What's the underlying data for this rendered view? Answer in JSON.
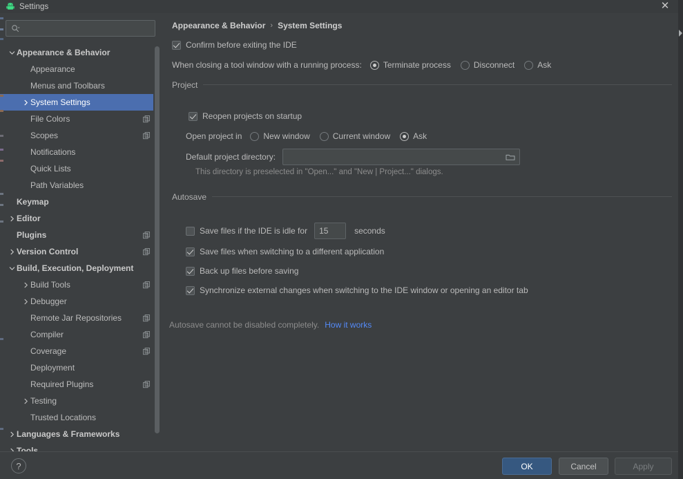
{
  "window": {
    "title": "Settings",
    "app_icon": "android-icon",
    "close_icon": "close-icon"
  },
  "sidebar": {
    "search": {
      "value": "",
      "placeholder": "",
      "icon": "search-icon"
    },
    "items": [
      {
        "label": "Appearance & Behavior",
        "indent": 0,
        "arrow": "down",
        "bold": true,
        "copy": false,
        "selected": false
      },
      {
        "label": "Appearance",
        "indent": 1,
        "arrow": "none",
        "bold": false,
        "copy": false,
        "selected": false
      },
      {
        "label": "Menus and Toolbars",
        "indent": 1,
        "arrow": "none",
        "bold": false,
        "copy": false,
        "selected": false
      },
      {
        "label": "System Settings",
        "indent": 1,
        "arrow": "right",
        "bold": false,
        "copy": false,
        "selected": true
      },
      {
        "label": "File Colors",
        "indent": 1,
        "arrow": "none",
        "bold": false,
        "copy": true,
        "selected": false
      },
      {
        "label": "Scopes",
        "indent": 1,
        "arrow": "none",
        "bold": false,
        "copy": true,
        "selected": false
      },
      {
        "label": "Notifications",
        "indent": 1,
        "arrow": "none",
        "bold": false,
        "copy": false,
        "selected": false
      },
      {
        "label": "Quick Lists",
        "indent": 1,
        "arrow": "none",
        "bold": false,
        "copy": false,
        "selected": false
      },
      {
        "label": "Path Variables",
        "indent": 1,
        "arrow": "none",
        "bold": false,
        "copy": false,
        "selected": false
      },
      {
        "label": "Keymap",
        "indent": 0,
        "arrow": "none",
        "bold": true,
        "copy": false,
        "selected": false
      },
      {
        "label": "Editor",
        "indent": 0,
        "arrow": "right",
        "bold": true,
        "copy": false,
        "selected": false
      },
      {
        "label": "Plugins",
        "indent": 0,
        "arrow": "none",
        "bold": true,
        "copy": true,
        "selected": false
      },
      {
        "label": "Version Control",
        "indent": 0,
        "arrow": "right",
        "bold": true,
        "copy": true,
        "selected": false
      },
      {
        "label": "Build, Execution, Deployment",
        "indent": 0,
        "arrow": "down",
        "bold": true,
        "copy": false,
        "selected": false
      },
      {
        "label": "Build Tools",
        "indent": 1,
        "arrow": "right",
        "bold": false,
        "copy": true,
        "selected": false
      },
      {
        "label": "Debugger",
        "indent": 1,
        "arrow": "right",
        "bold": false,
        "copy": false,
        "selected": false
      },
      {
        "label": "Remote Jar Repositories",
        "indent": 1,
        "arrow": "none",
        "bold": false,
        "copy": true,
        "selected": false
      },
      {
        "label": "Compiler",
        "indent": 1,
        "arrow": "none",
        "bold": false,
        "copy": true,
        "selected": false
      },
      {
        "label": "Coverage",
        "indent": 1,
        "arrow": "none",
        "bold": false,
        "copy": true,
        "selected": false
      },
      {
        "label": "Deployment",
        "indent": 1,
        "arrow": "none",
        "bold": false,
        "copy": false,
        "selected": false
      },
      {
        "label": "Required Plugins",
        "indent": 1,
        "arrow": "none",
        "bold": false,
        "copy": true,
        "selected": false
      },
      {
        "label": "Testing",
        "indent": 1,
        "arrow": "right",
        "bold": false,
        "copy": false,
        "selected": false
      },
      {
        "label": "Trusted Locations",
        "indent": 1,
        "arrow": "none",
        "bold": false,
        "copy": false,
        "selected": false
      },
      {
        "label": "Languages & Frameworks",
        "indent": 0,
        "arrow": "right",
        "bold": true,
        "copy": false,
        "selected": false
      },
      {
        "label": "Tools",
        "indent": 0,
        "arrow": "right",
        "bold": true,
        "copy": false,
        "selected": false
      }
    ]
  },
  "content": {
    "breadcrumb": {
      "parent": "Appearance & Behavior",
      "separator": "›",
      "current": "System Settings"
    },
    "confirm_exit": {
      "label": "Confirm before exiting the IDE",
      "checked": true
    },
    "tool_window": {
      "label": "When closing a tool window with a running process:",
      "options": [
        {
          "label": "Terminate process",
          "selected": true
        },
        {
          "label": "Disconnect",
          "selected": false
        },
        {
          "label": "Ask",
          "selected": false
        }
      ]
    },
    "project": {
      "group_label": "Project",
      "reopen": {
        "label": "Reopen projects on startup",
        "checked": true
      },
      "open_in": {
        "label": "Open project in",
        "options": [
          {
            "label": "New window",
            "selected": false
          },
          {
            "label": "Current window",
            "selected": false
          },
          {
            "label": "Ask",
            "selected": true
          }
        ]
      },
      "default_dir": {
        "label": "Default project directory:",
        "value": "",
        "placeholder": "",
        "browse_icon": "folder-icon"
      },
      "hint": "This directory is preselected in \"Open...\" and \"New | Project...\" dialogs."
    },
    "autosave": {
      "group_label": "Autosave",
      "idle": {
        "label_before": "Save files if the IDE is idle for",
        "value": "15",
        "label_after": "seconds",
        "checked": false
      },
      "items": [
        {
          "label": "Save files when switching to a different application",
          "checked": true
        },
        {
          "label": "Back up files before saving",
          "checked": true
        },
        {
          "label": "Synchronize external changes when switching to the IDE window or opening an editor tab",
          "checked": true
        }
      ],
      "footer_text": "Autosave cannot be disabled completely.",
      "footer_link": "How it works"
    }
  },
  "footer": {
    "help_icon": "?",
    "ok_label": "OK",
    "cancel_label": "Cancel",
    "apply_label": "Apply"
  },
  "colors": {
    "window_bg": "#3c3f41",
    "selection_blue": "#4b6eaf",
    "primary_button": "#365880",
    "link_blue": "#548af7",
    "android_green": "#3ddc84"
  }
}
